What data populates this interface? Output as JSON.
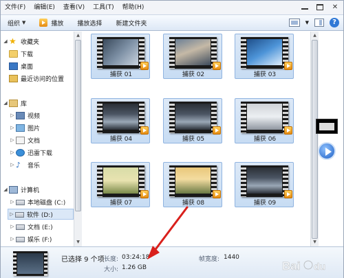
{
  "menu": [
    "文件(F)",
    "编辑(E)",
    "查看(V)",
    "工具(T)",
    "帮助(H)"
  ],
  "toolbar": {
    "organize": "组织",
    "play": "播放",
    "play_selection": "播放选择",
    "new_folder": "新建文件夹"
  },
  "nav": {
    "favorites": "收藏夹",
    "downloads": "下载",
    "desktop": "桌面",
    "recent": "最近访问的位置",
    "libraries": "库",
    "videos": "视频",
    "pictures": "图片",
    "documents": "文档",
    "xunlei": "迅雷下载",
    "music": "音乐",
    "computer": "计算机",
    "drive_c": "本地磁盘 (C:)",
    "drive_d": "软件 (D:)",
    "drive_e": "文档 (E:)",
    "drive_f": "娱乐 (F:)"
  },
  "files": [
    {
      "name": "捕获 01",
      "theme": "desk"
    },
    {
      "name": "捕获 02",
      "theme": "people"
    },
    {
      "name": "捕获 03",
      "theme": "blue"
    },
    {
      "name": "捕获 04",
      "theme": "app"
    },
    {
      "name": "捕获 05",
      "theme": "app"
    },
    {
      "name": "捕获 06",
      "theme": "light"
    },
    {
      "name": "捕获 07",
      "theme": "field"
    },
    {
      "name": "捕获 08",
      "theme": "landscape"
    },
    {
      "name": "捕获 09",
      "theme": "app"
    }
  ],
  "details": {
    "selected": "已选择 9 个项",
    "length_label": "长度:",
    "length_value": "03:24:18",
    "size_label": "大小:",
    "size_value": "1.26 GB",
    "frame_width_label": "帧宽度:",
    "frame_width_value": "1440"
  },
  "watermark": "Baidu 经验",
  "colors": {
    "selection": "#c7dcf3",
    "selection_border": "#8fb3e0",
    "annotation_arrow": "#d9201c"
  }
}
